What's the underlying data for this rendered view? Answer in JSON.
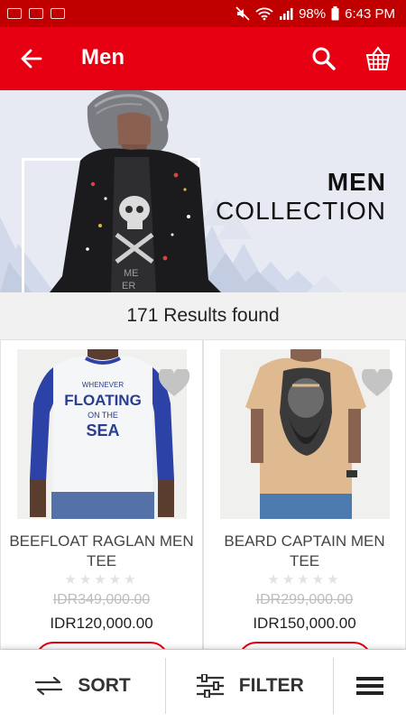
{
  "status": {
    "battery": "98%",
    "time": "6:43 PM"
  },
  "appbar": {
    "title": "Men"
  },
  "banner": {
    "line1": "MEN",
    "line2": "COLLECTION"
  },
  "results": {
    "text": "171 Results found"
  },
  "products": [
    {
      "name": "BEEFLOAT RAGLAN MEN TEE",
      "old_price": "IDR349,000.00",
      "price": "IDR120,000.00",
      "rating": 0,
      "shirt_text": [
        "WHENEVER",
        "FLOATING",
        "ON THE",
        "SEA"
      ]
    },
    {
      "name": "BEARD CAPTAIN MEN TEE",
      "old_price": "IDR299,000.00",
      "price": "IDR150,000.00",
      "rating": 0
    }
  ],
  "bottombar": {
    "sort_label": "SORT",
    "filter_label": "FILTER"
  },
  "colors": {
    "status_bar": "#c00000",
    "app_bar": "#e60012",
    "banner_bg": "#e7eaf3"
  },
  "icons": [
    "gallery-icon",
    "message-icon",
    "mail-icon",
    "mute-icon",
    "wifi-icon",
    "signal-icon",
    "battery-icon",
    "back-arrow-icon",
    "search-icon",
    "basket-icon",
    "heart-icon",
    "star-icon",
    "sort-icon",
    "filter-icon",
    "menu-icon"
  ]
}
